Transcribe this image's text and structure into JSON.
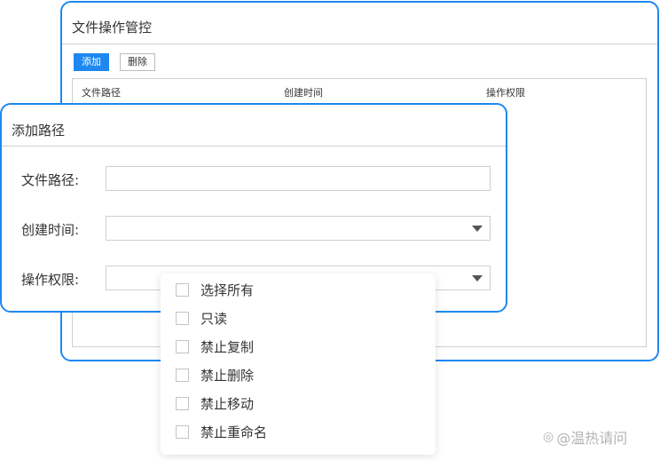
{
  "background_panel": {
    "title": "文件操作管控",
    "add_button": "添加",
    "delete_button": "删除",
    "table_headers": [
      "文件路径",
      "创建时间",
      "操作权限"
    ]
  },
  "dialog": {
    "title": "添加路径",
    "fields": [
      {
        "label": "文件路径:",
        "value": ""
      },
      {
        "label": "创建时间:",
        "value": ""
      },
      {
        "label": "操作权限:",
        "value": ""
      }
    ]
  },
  "permission_options": [
    {
      "label": "选择所有",
      "checked": false
    },
    {
      "label": "只读",
      "checked": false
    },
    {
      "label": "禁止复制",
      "checked": false
    },
    {
      "label": "禁止删除",
      "checked": false
    },
    {
      "label": "禁止移动",
      "checked": false
    },
    {
      "label": "禁止重命名",
      "checked": false
    }
  ],
  "watermark": {
    "text": "@温热请问",
    "icon": "weibo-icon"
  },
  "colors": {
    "accent": "#1e88f0",
    "border": "#cfcfcf",
    "text": "#333333"
  }
}
